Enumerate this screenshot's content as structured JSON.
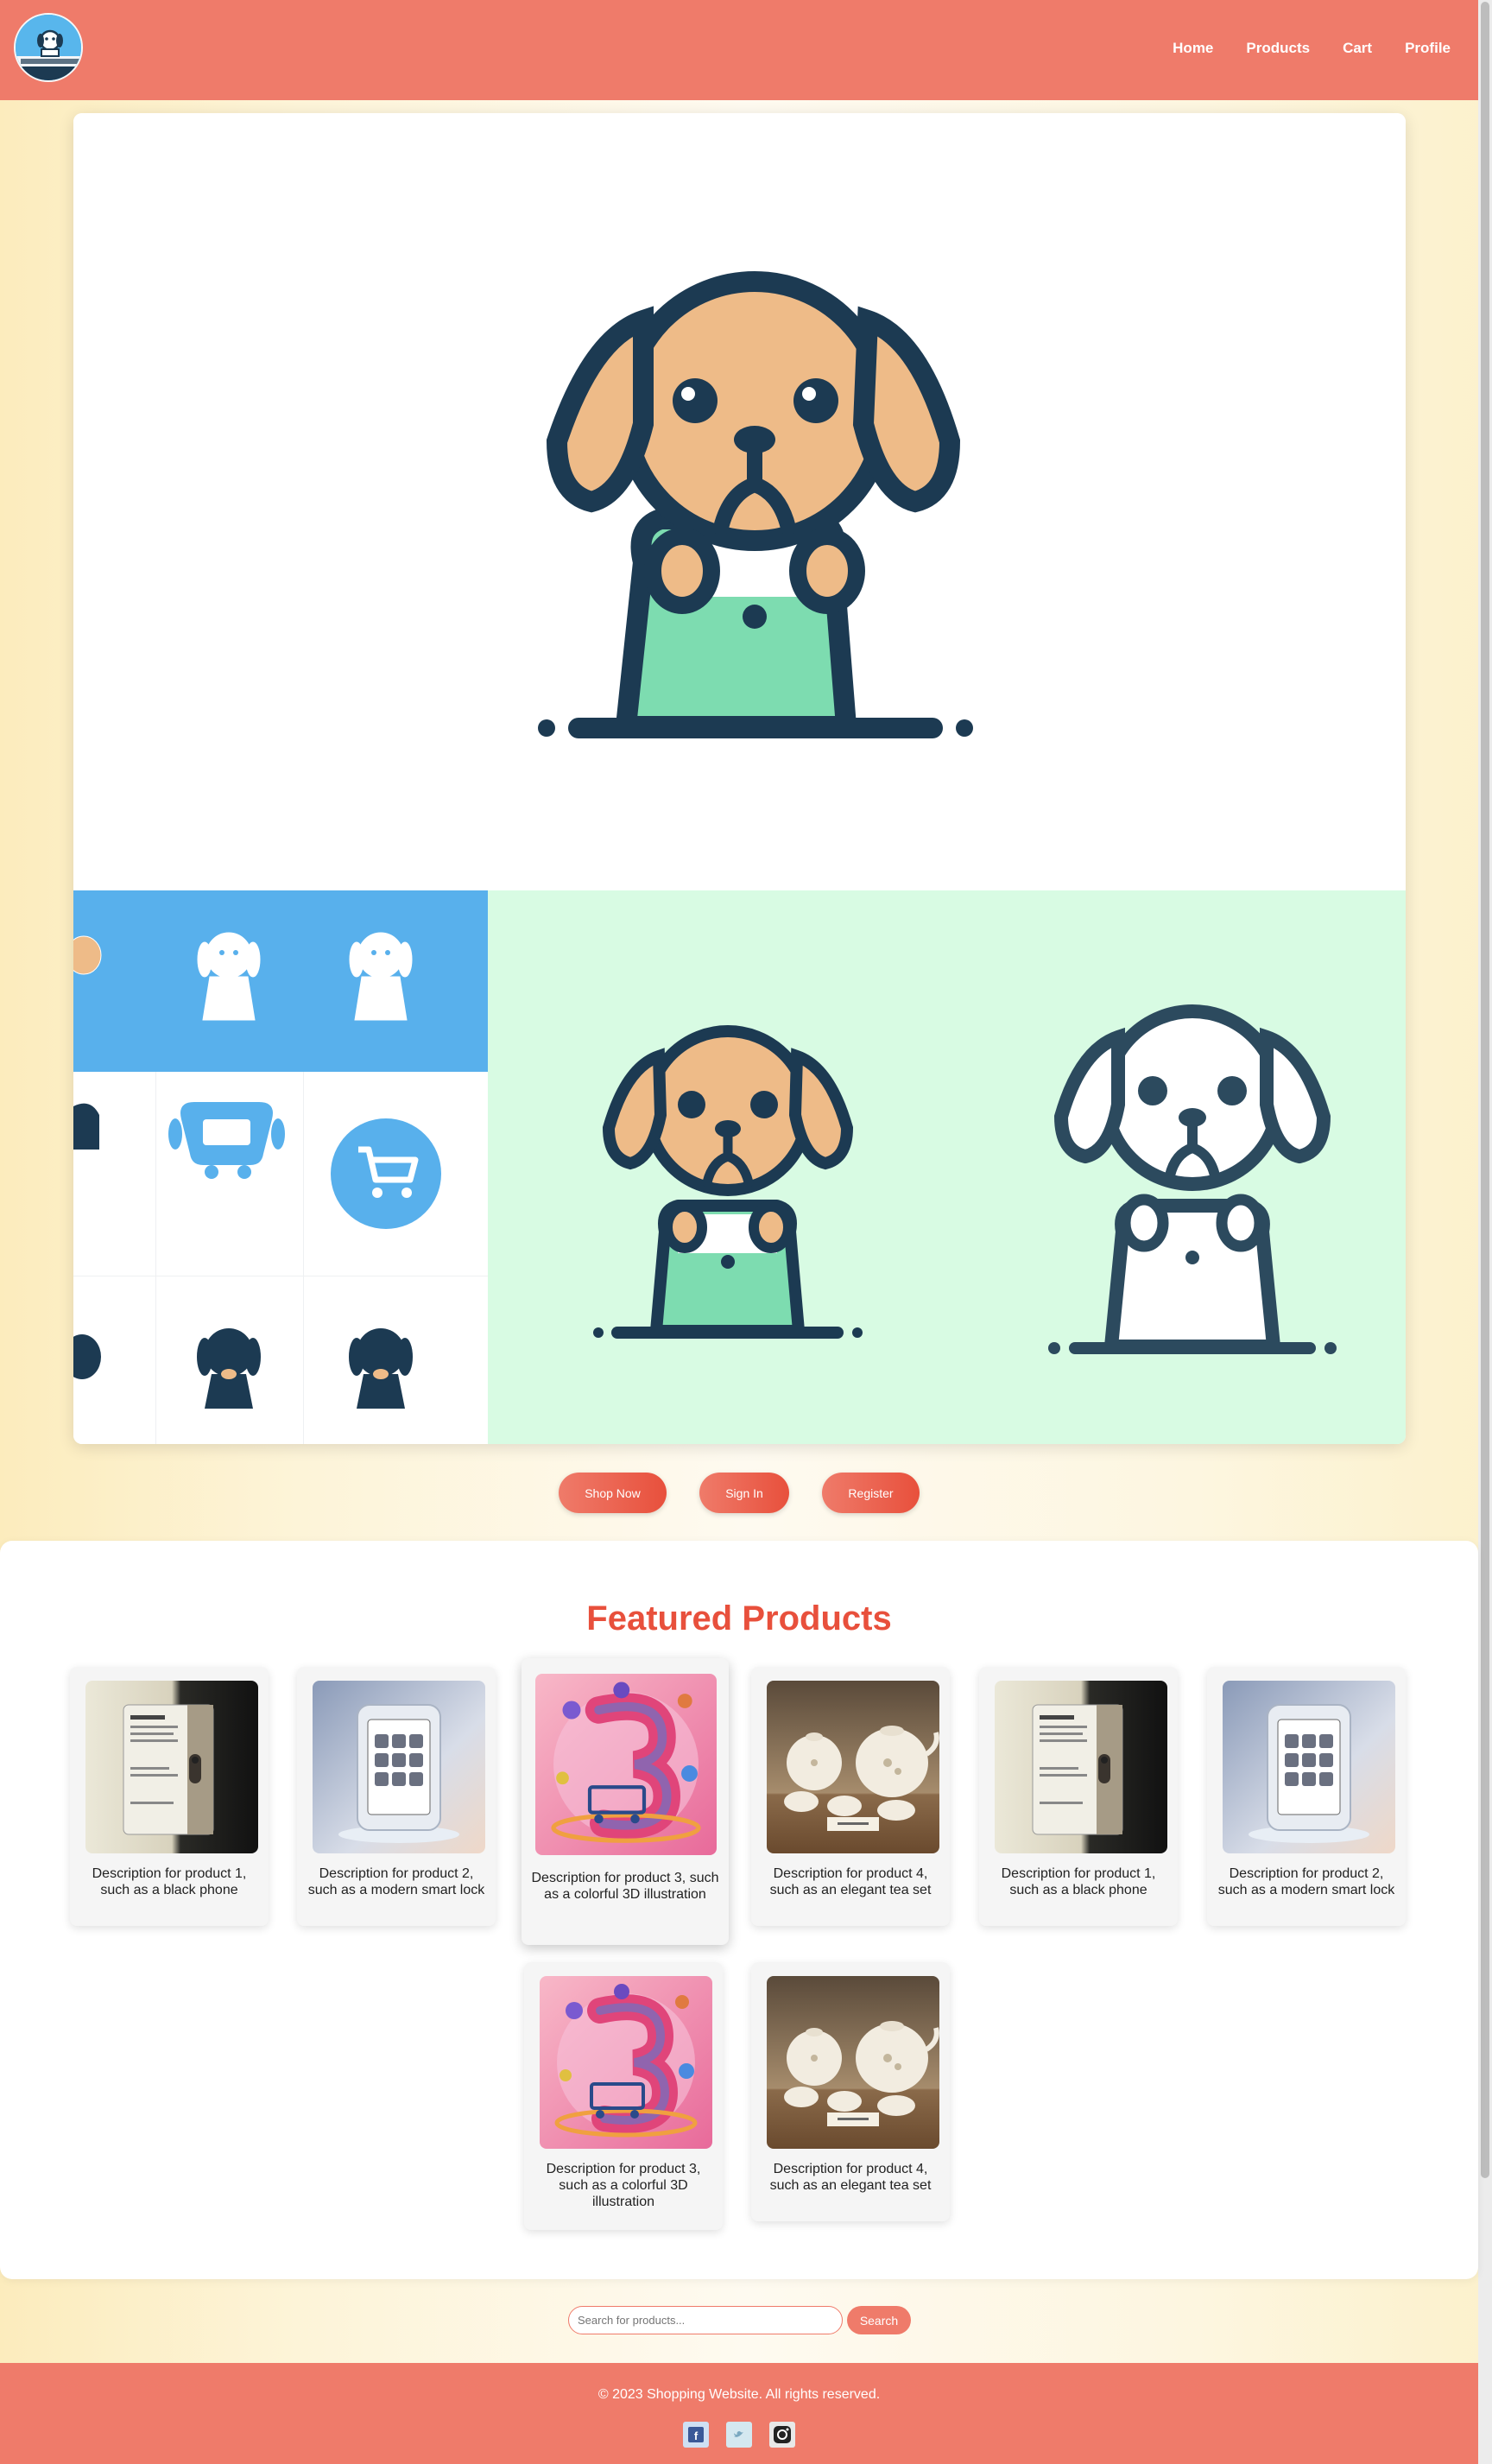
{
  "nav": {
    "items": [
      {
        "label": "Home"
      },
      {
        "label": "Products"
      },
      {
        "label": "Cart"
      },
      {
        "label": "Profile"
      }
    ]
  },
  "hero": {
    "buttons": {
      "shop_now": "Shop Now",
      "sign_in": "Sign In",
      "register": "Register"
    }
  },
  "featured": {
    "title": "Featured Products",
    "products": [
      {
        "desc": "Description for product 1, such as a black phone"
      },
      {
        "desc": "Description for product 2, such as a modern smart lock"
      },
      {
        "desc": "Description for product 3, such as a colorful 3D illustration"
      },
      {
        "desc": "Description for product 4, such as an elegant tea set"
      },
      {
        "desc": "Description for product 1, such as a black phone"
      },
      {
        "desc": "Description for product 2, such as a modern smart lock"
      },
      {
        "desc": "Description for product 3, such as a colorful 3D illustration"
      },
      {
        "desc": "Description for product 4, such as an elegant tea set"
      }
    ]
  },
  "search": {
    "placeholder": "Search for products...",
    "button": "Search"
  },
  "footer": {
    "copyright": "© 2023 Shopping Website. All rights reserved.",
    "social_icons": [
      "facebook-icon",
      "twitter-icon",
      "instagram-icon"
    ]
  },
  "colors": {
    "accent": "#ef7b6a",
    "title_red": "#e8503c",
    "mint": "#d8fbe3",
    "blue": "#58b0ec",
    "navy": "#1c3a52"
  }
}
